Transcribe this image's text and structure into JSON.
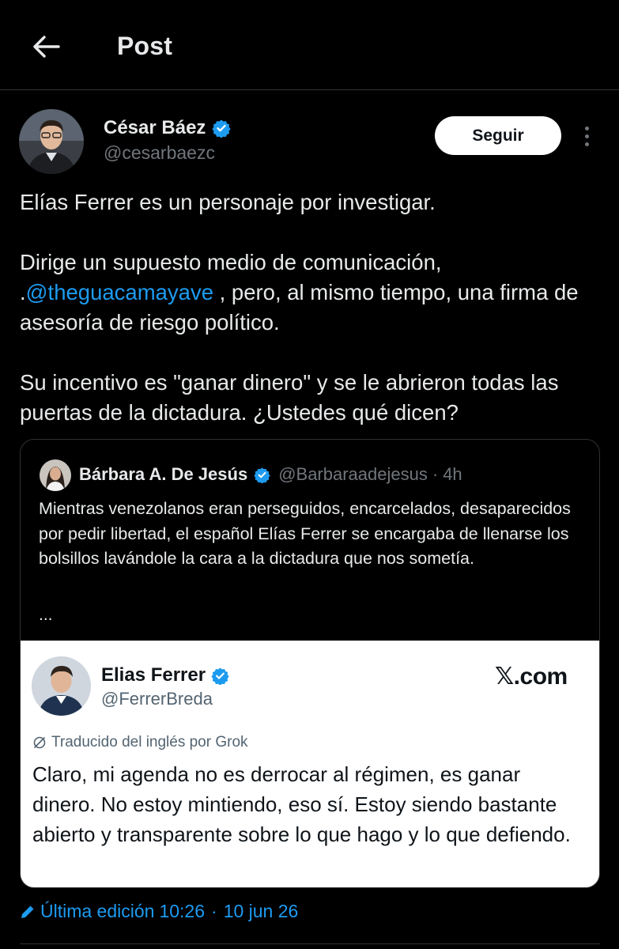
{
  "header": {
    "title": "Post",
    "back_icon": "arrow-left-icon"
  },
  "author": {
    "name": "César Báez",
    "handle": "@cesarbaezc",
    "verified_icon": "verified-badge-icon",
    "follow_label": "Seguir",
    "more_icon": "more-vertical-icon"
  },
  "post": {
    "paragraph1": "Elías Ferrer es un personaje por investigar.",
    "paragraph2_before": "Dirige un supuesto medio de comunicación, .",
    "paragraph2_mention": "@theguacamayave",
    "paragraph2_after": " , pero, al mismo tiempo, una firma de asesoría de riesgo político.",
    "paragraph3": "Su incentivo es \"ganar dinero\" y se le abrieron todas las puertas de la dictadura. ¿Ustedes qué dicen?"
  },
  "quote": {
    "name": "Bárbara A. De Jesús",
    "handle": "@Barbaraadejesus",
    "separator": "·",
    "time": "4h",
    "text": "Mientras venezolanos eran perseguidos, encarcelados, desaparecidos por pedir libertad, el español Elías Ferrer se encargaba de llenarse los bolsillos lavándole la cara a la dictadura que nos sometía.",
    "ellipsis": "..."
  },
  "embedded_post": {
    "name": "Elias Ferrer",
    "handle": "@FerrerBreda",
    "site": "𝕏.com",
    "translation_note": "Traducido del inglés por Grok",
    "text": "Claro, mi agenda no es derrocar al régimen, es ganar dinero. No estoy mintiendo, eso sí. Estoy siendo bastante abierto y transparente sobre lo que hago y lo que defiendo."
  },
  "footer": {
    "edit_label": "Última edición",
    "time": "10:26",
    "separator": "·",
    "date": "10 jun 26",
    "edit_icon": "pencil-icon"
  },
  "colors": {
    "accent": "#1d9bf0",
    "background": "#000000",
    "muted": "#71767b"
  }
}
